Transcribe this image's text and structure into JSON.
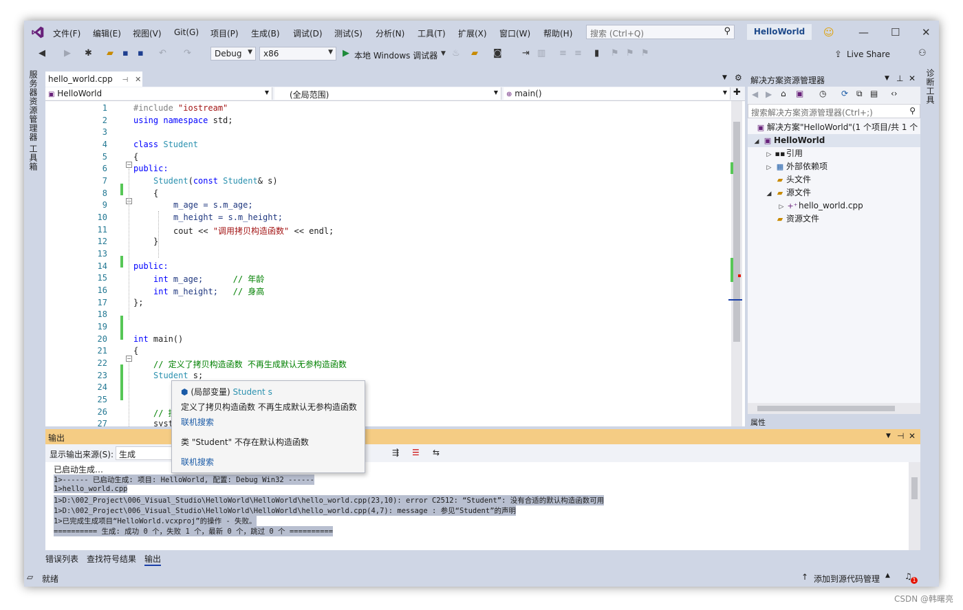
{
  "menu": {
    "file": "文件(F)",
    "edit": "编辑(E)",
    "view": "视图(V)",
    "git": "Git(G)",
    "project": "项目(P)",
    "build": "生成(B)",
    "debug": "调试(D)",
    "test": "测试(S)",
    "analyze": "分析(N)",
    "tools": "工具(T)",
    "extensions": "扩展(X)",
    "window": "窗口(W)",
    "help": "帮助(H)"
  },
  "search": {
    "placeholder": "搜索 (Ctrl+Q)"
  },
  "solution_name": "HelloWorld",
  "toolbar": {
    "config": "Debug",
    "platform": "x86",
    "run_label": "本地 Windows 调试器",
    "live_share": "Live Share"
  },
  "left_tabs": {
    "server_explorer": "服务器资源管理器",
    "toolbox": "工具箱"
  },
  "right_tabs": {
    "diagnostic": "诊断工具"
  },
  "editor": {
    "tab_name": "hello_world.cpp",
    "nav_project": "HelloWorld",
    "nav_scope": "(全局范围)",
    "nav_member": "main()",
    "line_numbers": [
      "1",
      "2",
      "3",
      "4",
      "5",
      "6",
      "7",
      "8",
      "9",
      "10",
      "11",
      "12",
      "13",
      "14",
      "15",
      "16",
      "17",
      "18",
      "19",
      "20",
      "21",
      "22",
      "23",
      "24",
      "25",
      "26",
      "27"
    ]
  },
  "code": {
    "l1_pp": "#include ",
    "l1_str": "\"iostream\"",
    "l2_kw": "using namespace",
    "l2_rest": " std;",
    "l4_kw": "class",
    "l4_ty": " Student",
    "l5": "{",
    "l6": "public:",
    "l7_ty": "Student",
    "l7_p": "(",
    "l7_kw": "const",
    "l7_ty2": " Student",
    "l7_rest": "& s)",
    "l8": "{",
    "l9": "m_age = s.m_age;",
    "l10": "m_height = s.m_height;",
    "l11_a": "cout << ",
    "l11_str": "\"调用拷贝构造函数\"",
    "l11_b": " << endl;",
    "l12": "}",
    "l14": "public:",
    "l15_kw": "int",
    "l15_rest": " m_age;      ",
    "l15_cm": "// 年龄",
    "l16_kw": "int",
    "l16_rest": " m_height;   ",
    "l16_cm": "// 身高",
    "l17": "};",
    "l20_kw": "int",
    "l20_rest": " main()",
    "l21": "{",
    "l22_cm": "// 定义了拷贝构造函数 不再生成默认无参构造函数",
    "l23_ty": "Student",
    "l23_rest": " s;",
    "l26_cm": "// 控制台",
    "l27": "system(\""
  },
  "tooltip": {
    "kind": "(局部变量)",
    "type": "Student s",
    "description": "定义了拷贝构造函数 不再生成默认无参构造函数",
    "search1": "联机搜索",
    "error": "类 \"Student\" 不存在默认构造函数",
    "search2": "联机搜索"
  },
  "solution_explorer": {
    "title": "解决方案资源管理器",
    "search_placeholder": "搜索解决方案资源管理器(Ctrl+;)",
    "solution_row": "解决方案\"HelloWorld\"(1 个项目/共 1 个",
    "project": "HelloWorld",
    "references": "引用",
    "external_deps": "外部依赖项",
    "headers": "头文件",
    "sources": "源文件",
    "source_file": "hello_world.cpp",
    "resources": "资源文件"
  },
  "properties": {
    "title": "属性"
  },
  "output": {
    "title": "输出",
    "source_label": "显示输出来源(S):",
    "source_value": "生成",
    "lines": [
      "已启动生成…",
      "1>------ 已启动生成: 项目: HelloWorld, 配置: Debug Win32 ------",
      "1>hello_world.cpp",
      "1>D:\\002_Project\\006_Visual_Studio\\HelloWorld\\HelloWorld\\hello_world.cpp(23,10): error C2512: “Student”: 没有合适的默认构造函数可用",
      "1>D:\\002_Project\\006_Visual_Studio\\HelloWorld\\HelloWorld\\hello_world.cpp(4,7): message : 参见“Student”的声明",
      "1>已完成生成项目“HelloWorld.vcxproj”的操作 - 失败。",
      "========== 生成: 成功 0 个，失败 1 个，最新 0 个，跳过 0 个 =========="
    ]
  },
  "bottom_tabs": {
    "error_list": "错误列表",
    "find_symbol": "查找符号结果",
    "output": "输出"
  },
  "status": {
    "ready": "就绪",
    "source_control": "添加到源代码管理",
    "notifications": "1"
  },
  "watermark": "CSDN @韩曙亮",
  "colors": {
    "vs_purple": "#68217a",
    "output_header": "#f5cc84",
    "chrome": "#cfd6e5"
  }
}
